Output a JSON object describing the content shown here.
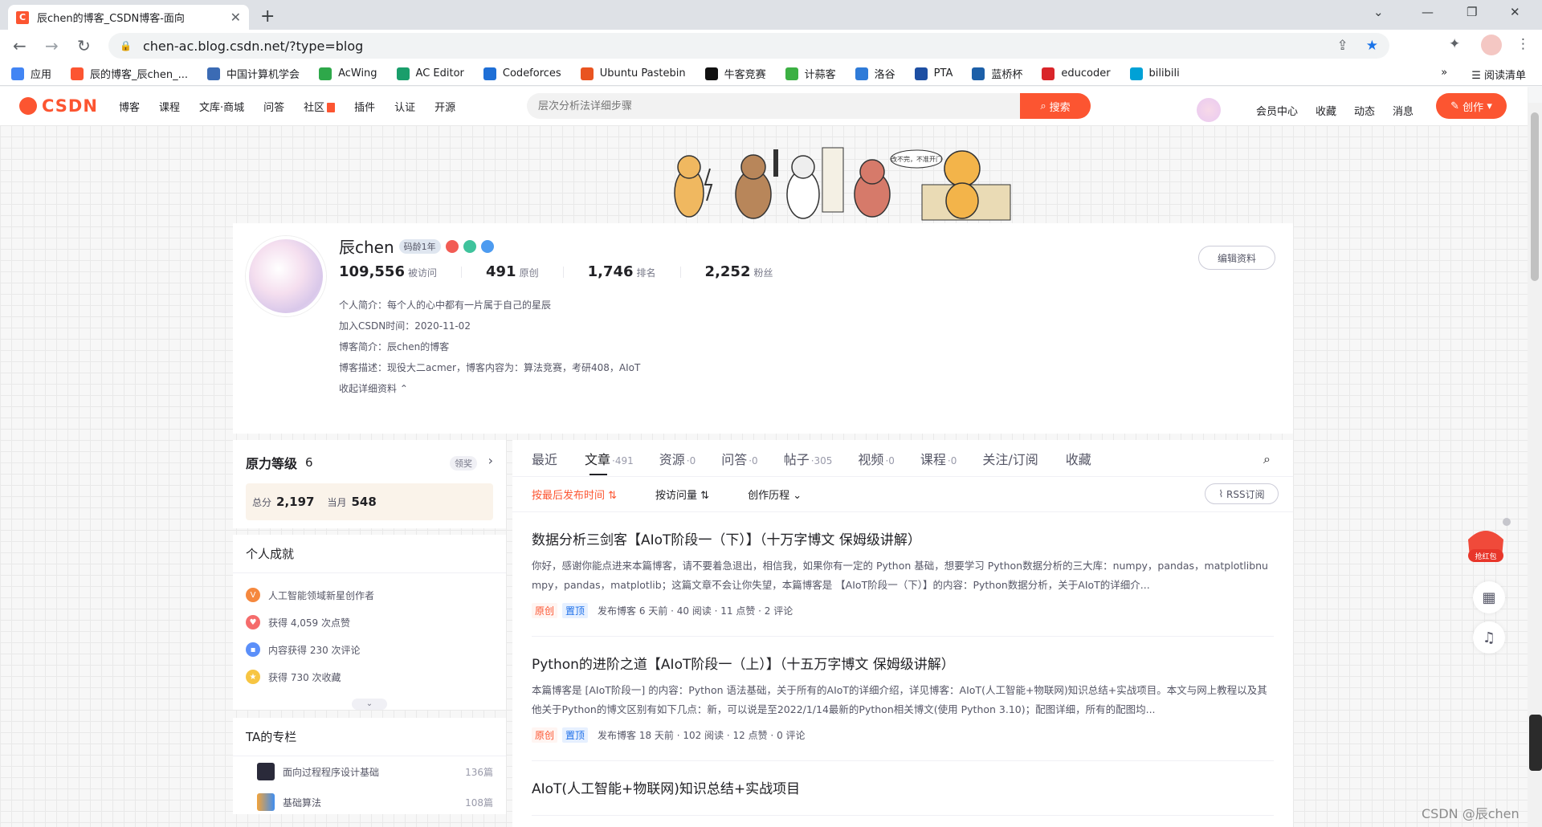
{
  "browser": {
    "tab_title": "辰chen的博客_CSDN博客-面向",
    "url": "chen-ac.blog.csdn.net/?type=blog",
    "bookmarks": [
      "应用",
      "辰的博客_辰chen_...",
      "中国计算机学会",
      "AcWing",
      "AC Editor",
      "Codeforces",
      "Ubuntu Pastebin",
      "牛客竞赛",
      "计蒜客",
      "洛谷",
      "PTA",
      "蓝桥杯",
      "educoder",
      "bilibili"
    ],
    "bookmark_colors": [
      "#4285f4",
      "#fc5531",
      "#3b6bb4",
      "#2ea84a",
      "#1a9e6b",
      "#1f6fd6",
      "#e95420",
      "#111111",
      "#3cb043",
      "#2f7bd8",
      "#1d4fa3",
      "#1c5fa8",
      "#d9252a",
      "#00a1d6"
    ],
    "reading_list": "阅读清单"
  },
  "csdn_nav": {
    "logo": "CSDN",
    "links": [
      "博客",
      "课程",
      "文库·商城",
      "问答",
      "社区",
      "插件",
      "认证",
      "开源"
    ],
    "search_placeholder": "层次分析法详细步骤",
    "search_btn": "搜索",
    "right_links": [
      "会员中心",
      "收藏",
      "动态",
      "消息"
    ],
    "create_btn": "创作"
  },
  "profile": {
    "name": "辰chen",
    "tag": "码龄1年",
    "stats": [
      {
        "num": "109,556",
        "label": "被访问"
      },
      {
        "num": "491",
        "label": "原创"
      },
      {
        "num": "1,746",
        "label": "排名"
      },
      {
        "num": "2,252",
        "label": "粉丝"
      }
    ],
    "intro": "个人简介：每个人的心中都有一片属于自己的星辰",
    "join": "加入CSDN时间：2020-11-02",
    "blog_intro": "博客简介：辰chen的博客",
    "blog_desc": "博客描述：现役大二acmer，博客内容为：算法竞赛，考研408，AIoT",
    "collapse": "收起详细资料",
    "edit_btn": "编辑资料"
  },
  "sidebar": {
    "level_title": "原力等级",
    "level_num": "6",
    "level_btn": "领奖",
    "total_label": "总分",
    "total": "2,197",
    "month_label": "当月",
    "month": "548",
    "achv_title": "个人成就",
    "achievements": [
      "人工智能领域新星创作者",
      "获得 4,059 次点赞",
      "内容获得 230 次评论",
      "获得 730 次收藏"
    ],
    "columns_title": "TA的专栏",
    "columns": [
      {
        "name": "面向过程程序设计基础",
        "count": "136篇"
      },
      {
        "name": "基础算法",
        "count": "108篇"
      }
    ]
  },
  "main": {
    "tabs": [
      {
        "label": "最近",
        "count": ""
      },
      {
        "label": "文章",
        "count": "·491"
      },
      {
        "label": "资源",
        "count": "·0"
      },
      {
        "label": "问答",
        "count": "·0"
      },
      {
        "label": "帖子",
        "count": "·305"
      },
      {
        "label": "视频",
        "count": "·0"
      },
      {
        "label": "课程",
        "count": "·0"
      },
      {
        "label": "关注/订阅",
        "count": ""
      },
      {
        "label": "收藏",
        "count": ""
      }
    ],
    "sort": [
      "按最后发布时间 ⇅",
      "按访问量 ⇅",
      "创作历程"
    ],
    "rss": "RSS订阅",
    "articles": [
      {
        "title": "数据分析三剑客【AIoT阶段一（下）】（十万字博文 保姆级讲解）",
        "desc": "你好，感谢你能点进来本篇博客，请不要着急退出，相信我，如果你有一定的 Python 基础，想要学习 Python数据分析的三大库：numpy，pandas，matplotlibnumpy，pandas，matplotlib；这篇文章不会让你失望，本篇博客是 【AIoT阶段一（下）】的内容：Python数据分析，关于AIoT的详细介...",
        "tag1": "原创",
        "tag2": "置顶",
        "meta": "发布博客 6 天前 · 40 阅读 · 11 点赞 · 2 评论"
      },
      {
        "title": "Python的进阶之道【AIoT阶段一（上）】（十五万字博文 保姆级讲解）",
        "desc": "本篇博客是 [AIoT阶段一] 的内容：Python 语法基础，关于所有的AIoT的详细介绍，详见博客：AIoT(人工智能+物联网)知识总结+实战项目。本文与网上教程以及其他关于Python的博文区别有如下几点：新，可以说是至2022/1/14最新的Python相关博文(使用 Python 3.10)；配图详细，所有的配图均...",
        "tag1": "原创",
        "tag2": "置顶",
        "meta": "发布博客 18 天前 · 102 阅读 · 12 点赞 · 0 评论"
      },
      {
        "title": "AIoT(人工智能+物联网)知识总结+实战项目",
        "desc": "",
        "tag1": "",
        "tag2": "",
        "meta": ""
      }
    ]
  },
  "float": {
    "gift": "抢红包"
  },
  "watermark": "CSDN @辰chen"
}
